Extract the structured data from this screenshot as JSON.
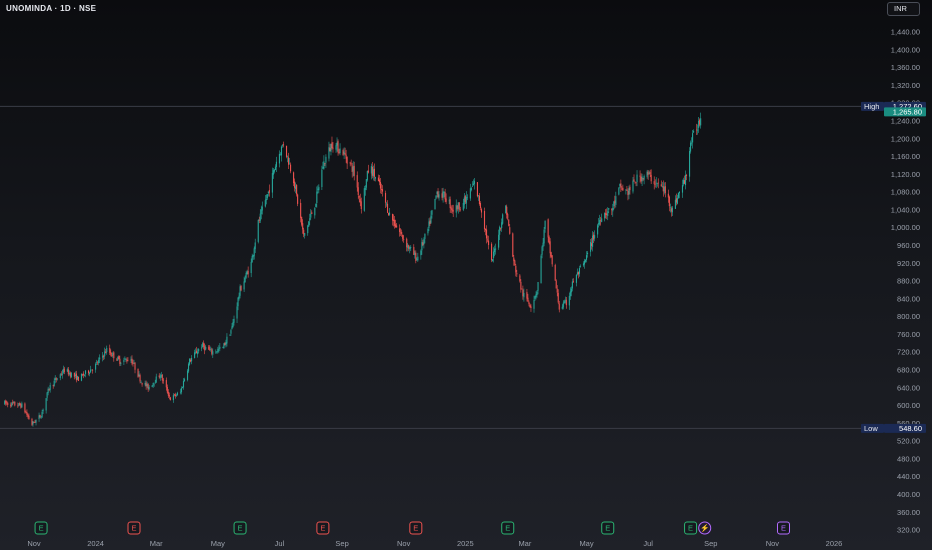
{
  "header": {
    "symbol_title": "UNOMINDA · 1D · NSE",
    "currency": "INR"
  },
  "chart_data": {
    "type": "candlestick",
    "interval": "1D",
    "exchange": "NSE",
    "y_axis": {
      "ticks": [
        320,
        360,
        400,
        440,
        480,
        520,
        560,
        600,
        640,
        680,
        720,
        760,
        800,
        840,
        880,
        920,
        960,
        1000,
        1040,
        1080,
        1120,
        1160,
        1200,
        1240,
        1280,
        1320,
        1360,
        1400,
        1440
      ],
      "tick_labels": [
        "320.00",
        "360.00",
        "400.00",
        "440.00",
        "480.00",
        "520.00",
        "560.00",
        "600.00",
        "640.00",
        "680.00",
        "720.00",
        "760.00",
        "800.00",
        "840.00",
        "880.00",
        "920.00",
        "960.00",
        "1,000.00",
        "1,040.00",
        "1,080.00",
        "1,120.00",
        "1,160.00",
        "1,200.00",
        "1,240.00",
        "1,280.00",
        "1,320.00",
        "1,360.00",
        "1,400.00",
        "1,440.00"
      ],
      "range": [
        310,
        1470
      ]
    },
    "x_axis": {
      "labels": [
        {
          "text": "Nov",
          "date": "2023-11-01"
        },
        {
          "text": "2024",
          "date": "2024-01-01"
        },
        {
          "text": "Mar",
          "date": "2024-03-01"
        },
        {
          "text": "May",
          "date": "2024-05-01"
        },
        {
          "text": "Jul",
          "date": "2024-07-01"
        },
        {
          "text": "Sep",
          "date": "2024-09-01"
        },
        {
          "text": "Nov",
          "date": "2024-11-01"
        },
        {
          "text": "2025",
          "date": "2025-01-01"
        },
        {
          "text": "Mar",
          "date": "2025-03-01"
        },
        {
          "text": "May",
          "date": "2025-05-01"
        },
        {
          "text": "Jul",
          "date": "2025-07-01"
        },
        {
          "text": "Sep",
          "date": "2025-09-01"
        },
        {
          "text": "Nov",
          "date": "2025-11-01"
        },
        {
          "text": "2026",
          "date": "2026-01-01"
        }
      ]
    },
    "high": {
      "label": "High",
      "value": 1272.6,
      "text": "1,272.60"
    },
    "low": {
      "label": "Low",
      "value": 548.6,
      "text": "548.60"
    },
    "last_price": {
      "value": 1265.8,
      "text": "1,265.80"
    },
    "path": [
      [
        "2023-10-03",
        605
      ],
      [
        "2023-10-20",
        600
      ],
      [
        "2023-10-30",
        558
      ],
      [
        "2023-11-08",
        578
      ],
      [
        "2023-11-16",
        640
      ],
      [
        "2023-12-01",
        680
      ],
      [
        "2023-12-15",
        660
      ],
      [
        "2024-01-01",
        690
      ],
      [
        "2024-01-12",
        725
      ],
      [
        "2024-01-25",
        700
      ],
      [
        "2024-02-05",
        705
      ],
      [
        "2024-02-15",
        655
      ],
      [
        "2024-02-22",
        640
      ],
      [
        "2024-03-05",
        670
      ],
      [
        "2024-03-15",
        615
      ],
      [
        "2024-03-25",
        630
      ],
      [
        "2024-04-03",
        700
      ],
      [
        "2024-04-15",
        735
      ],
      [
        "2024-04-25",
        720
      ],
      [
        "2024-05-06",
        730
      ],
      [
        "2024-05-15",
        775
      ],
      [
        "2024-05-23",
        860
      ],
      [
        "2024-06-03",
        920
      ],
      [
        "2024-06-10",
        1010
      ],
      [
        "2024-06-20",
        1080
      ],
      [
        "2024-06-28",
        1150
      ],
      [
        "2024-07-05",
        1190
      ],
      [
        "2024-07-15",
        1110
      ],
      [
        "2024-07-25",
        980
      ],
      [
        "2024-08-06",
        1060
      ],
      [
        "2024-08-13",
        1140
      ],
      [
        "2024-08-22",
        1190
      ],
      [
        "2024-09-02",
        1170
      ],
      [
        "2024-09-12",
        1130
      ],
      [
        "2024-09-20",
        1050
      ],
      [
        "2024-09-28",
        1140
      ],
      [
        "2024-10-07",
        1100
      ],
      [
        "2024-10-18",
        1030
      ],
      [
        "2024-10-28",
        990
      ],
      [
        "2024-11-06",
        955
      ],
      [
        "2024-11-14",
        930
      ],
      [
        "2024-11-25",
        995
      ],
      [
        "2024-12-04",
        1080
      ],
      [
        "2024-12-12",
        1070
      ],
      [
        "2024-12-20",
        1040
      ],
      [
        "2025-01-01",
        1060
      ],
      [
        "2025-01-10",
        1100
      ],
      [
        "2025-01-17",
        1040
      ],
      [
        "2025-01-27",
        920
      ],
      [
        "2025-02-03",
        990
      ],
      [
        "2025-02-10",
        1050
      ],
      [
        "2025-02-18",
        920
      ],
      [
        "2025-02-27",
        850
      ],
      [
        "2025-03-07",
        825
      ],
      [
        "2025-03-13",
        860
      ],
      [
        "2025-03-21",
        1010
      ],
      [
        "2025-03-28",
        920
      ],
      [
        "2025-04-04",
        820
      ],
      [
        "2025-04-11",
        830
      ],
      [
        "2025-04-18",
        880
      ],
      [
        "2025-04-29",
        920
      ],
      [
        "2025-05-08",
        980
      ],
      [
        "2025-05-16",
        1030
      ],
      [
        "2025-05-26",
        1040
      ],
      [
        "2025-06-03",
        1090
      ],
      [
        "2025-06-11",
        1080
      ],
      [
        "2025-06-20",
        1110
      ],
      [
        "2025-06-30",
        1120
      ],
      [
        "2025-07-09",
        1100
      ],
      [
        "2025-07-17",
        1085
      ],
      [
        "2025-07-25",
        1040
      ],
      [
        "2025-08-01",
        1080
      ],
      [
        "2025-08-07",
        1110
      ],
      [
        "2025-08-12",
        1190
      ],
      [
        "2025-08-19",
        1230
      ],
      [
        "2025-08-25",
        1266
      ]
    ],
    "events": [
      {
        "label": "E",
        "date": "2023-11-08",
        "kind": "earnings-reported"
      },
      {
        "label": "E",
        "date": "2024-02-08",
        "kind": "earnings-missed"
      },
      {
        "label": "E",
        "date": "2024-05-23",
        "kind": "earnings-reported"
      },
      {
        "label": "E",
        "date": "2024-08-13",
        "kind": "earnings-missed"
      },
      {
        "label": "E",
        "date": "2024-11-13",
        "kind": "earnings-missed"
      },
      {
        "label": "E",
        "date": "2025-02-12",
        "kind": "earnings-reported"
      },
      {
        "label": "E",
        "date": "2025-05-22",
        "kind": "earnings-reported"
      },
      {
        "label": "E",
        "date": "2025-08-12",
        "kind": "earnings-reported"
      },
      {
        "label": "⚡",
        "date": "2025-08-26",
        "kind": "dividend"
      },
      {
        "label": "E",
        "date": "2025-11-12",
        "kind": "earnings-upcoming"
      }
    ],
    "colors": {
      "up": "#26a69a",
      "down": "#ef5350",
      "grid_line": "#3a3d46",
      "axis_text": "#9aa0ab",
      "high_low_tag": "#1b2a55",
      "last_price_tag": "#1a8c80",
      "earnings_reported": "#2bb673",
      "earnings_missed": "#ef5350",
      "dividend": "#b36bff",
      "earnings_upcoming": "#b36bff"
    }
  }
}
